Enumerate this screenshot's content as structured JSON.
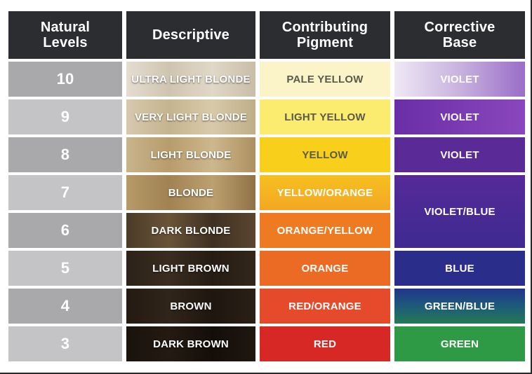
{
  "headers": {
    "natural_levels": "Natural\nLevels",
    "descriptive": "Descriptive",
    "contributing_pigment": "Contributing\nPigment",
    "corrective_base": "Corrective\nBase"
  },
  "rows": [
    {
      "level": "10",
      "descriptive": "ULTRA LIGHT BLONDE",
      "pigment": "PALE YELLOW",
      "corrective": "VIOLET"
    },
    {
      "level": "9",
      "descriptive": "VERY LIGHT BLONDE",
      "pigment": "LIGHT YELLOW",
      "corrective": "VIOLET"
    },
    {
      "level": "8",
      "descriptive": "LIGHT BLONDE",
      "pigment": "YELLOW",
      "corrective": "VIOLET"
    },
    {
      "level": "7",
      "descriptive": "BLONDE",
      "pigment": "YELLOW/ORANGE",
      "corrective": "VIOLET/BLUE"
    },
    {
      "level": "6",
      "descriptive": "DARK BLONDE",
      "pigment": "ORANGE/YELLOW",
      "corrective": ""
    },
    {
      "level": "5",
      "descriptive": "LIGHT BROWN",
      "pigment": "ORANGE",
      "corrective": "BLUE"
    },
    {
      "level": "4",
      "descriptive": "BROWN",
      "pigment": "RED/ORANGE",
      "corrective": "GREEN/BLUE"
    },
    {
      "level": "3",
      "descriptive": "DARK BROWN",
      "pigment": "RED",
      "corrective": "GREEN"
    }
  ],
  "colors": {
    "header_bg": "#2b2d30",
    "level_bg_alt_a": "#a9a9ab",
    "level_bg_alt_b": "#c4c4c6",
    "hair": [
      "#d8d0c2",
      "#cdbf9f",
      "#c0a77c",
      "#b0935f",
      "#5c4a34",
      "#2f241b",
      "#231a13",
      "#17110c"
    ],
    "pigment": [
      "#fbf4c9",
      "#fbeb6f",
      "#f8cc1a",
      "#f2a722",
      "#ee7b21",
      "#e9562a",
      "#e23b2b",
      "#d82826"
    ],
    "corrective": [
      "#d9cdea",
      "#7b3db0",
      "#5a2a96",
      "#4b2a98",
      "#2b2a86",
      "#1f3d8a",
      "#2f8a3d"
    ]
  }
}
